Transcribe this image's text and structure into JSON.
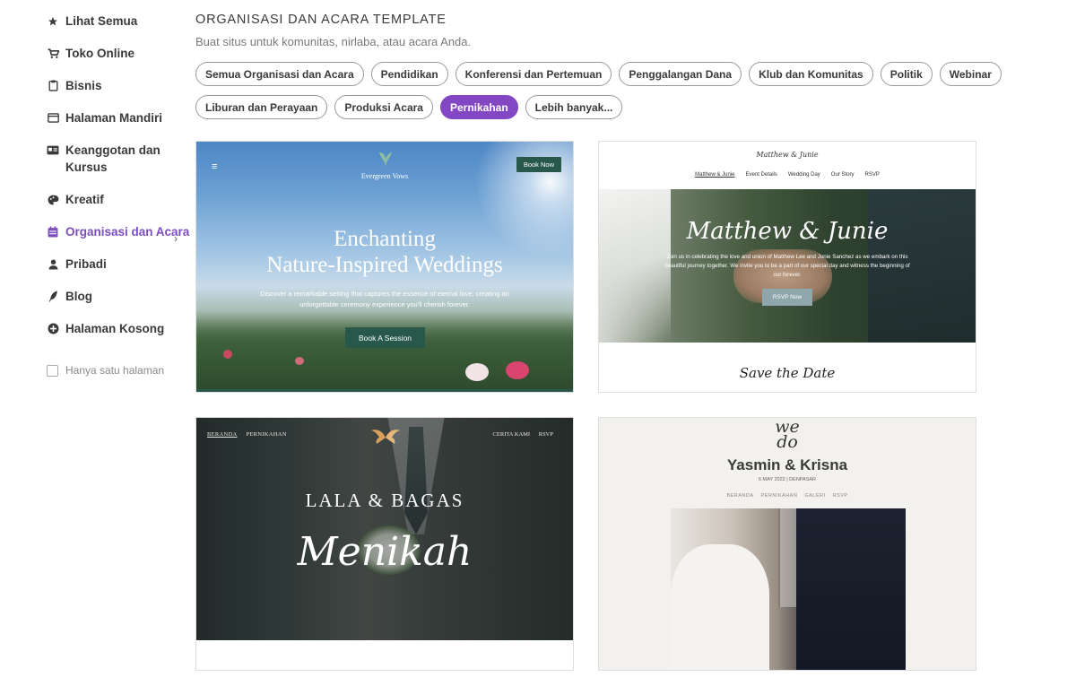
{
  "sidebar": {
    "items": [
      {
        "label": "Lihat Semua",
        "icon": "star-icon"
      },
      {
        "label": "Toko Online",
        "icon": "cart-icon"
      },
      {
        "label": "Bisnis",
        "icon": "clipboard-icon"
      },
      {
        "label": "Halaman Mandiri",
        "icon": "browser-window-icon"
      },
      {
        "label": "Keanggotan dan Kursus",
        "icon": "id-card-icon"
      },
      {
        "label": "Kreatif",
        "icon": "palette-icon"
      },
      {
        "label": "Organisasi dan Acara",
        "icon": "calendar-icon",
        "active": true
      },
      {
        "label": "Pribadi",
        "icon": "person-icon"
      },
      {
        "label": "Blog",
        "icon": "quill-icon"
      },
      {
        "label": "Halaman Kosong",
        "icon": "plus-circle-icon"
      }
    ],
    "single_page_label": "Hanya satu halaman",
    "single_page_checked": false
  },
  "main": {
    "title": "ORGANISASI DAN ACARA TEMPLATE",
    "subtitle": "Buat situs untuk komunitas, nirlaba, atau acara Anda.",
    "filters_row1": [
      "Semua Organisasi dan Acara",
      "Pendidikan",
      "Konferensi dan Pertemuan",
      "Penggalangan Dana",
      "Klub dan Komunitas",
      "Politik",
      "Webinar"
    ],
    "filters_row2": [
      "Liburan dan Perayaan",
      "Produksi Acara",
      "Pernikahan",
      "Lebih banyak..."
    ],
    "active_filter": "Pernikahan"
  },
  "templates": {
    "evergreen": {
      "brand": "Evergreen Vows",
      "book_button": "Book Now",
      "title_line1": "Enchanting",
      "title_line2": "Nature-Inspired Weddings",
      "description": "Discover a remarkable setting that captures the essence of eternal love, creating an unforgettable ceremony experience you'll cherish forever.",
      "cta": "Book A Session",
      "accent": "#27584a"
    },
    "matthew_junie": {
      "logo": "Matthew & Junie",
      "nav": [
        "Matthew & Junie",
        "Event Details",
        "Wedding Day",
        "Our Story",
        "RSVP"
      ],
      "hero_title": "Matthew & Junie",
      "hero_text": "Join us in celebrating the love and union of Matthew Lee and Junie Sanchez as we embark on this beautiful journey together. We invite you to be a part of our special day and witness the beginning of our forever.",
      "rsvp_button": "RSVP Now",
      "save_the_date": "Save the Date"
    },
    "lala_bagas": {
      "nav_left": [
        "BERANDA",
        "PERNIKAHAN"
      ],
      "nav_right": [
        "CERITA KAMI",
        "RSVP"
      ],
      "names": "LALA & BAGAS",
      "script": "Menikah"
    },
    "yasmin_krisna": {
      "monogram_line1": "we",
      "monogram_line2": "do",
      "names": "Yasmin & Krisna",
      "date": "6 MAY 2022 | DENPASAR",
      "nav": [
        "BERANDA",
        "PERNIKAHAN",
        "GALERI",
        "RSVP"
      ]
    }
  }
}
